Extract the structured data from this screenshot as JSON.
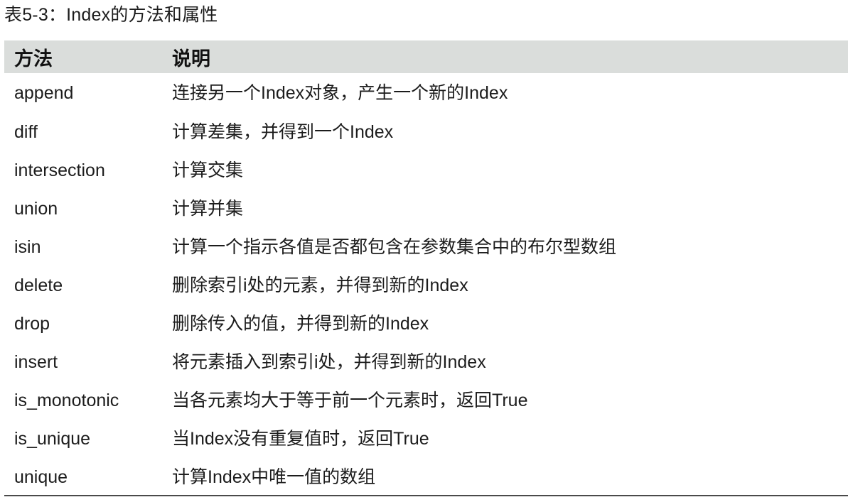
{
  "caption": "表5-3：Index的方法和属性",
  "table": {
    "columns": [
      {
        "key": "method",
        "label": "方法"
      },
      {
        "key": "description",
        "label": "说明"
      }
    ],
    "rows": [
      {
        "method": "append",
        "description": "连接另一个Index对象，产生一个新的Index"
      },
      {
        "method": "diff",
        "description": "计算差集，并得到一个Index"
      },
      {
        "method": "intersection",
        "description": "计算交集"
      },
      {
        "method": "union",
        "description": "计算并集"
      },
      {
        "method": "isin",
        "description": "计算一个指示各值是否都包含在参数集合中的布尔型数组"
      },
      {
        "method": "delete",
        "description": "删除索引i处的元素，并得到新的Index"
      },
      {
        "method": "drop",
        "description": "删除传入的值，并得到新的Index"
      },
      {
        "method": "insert",
        "description": "将元素插入到索引i处，并得到新的Index"
      },
      {
        "method": "is_monotonic",
        "description": "当各元素均大于等于前一个元素时，返回True"
      },
      {
        "method": "is_unique",
        "description": "当Index没有重复值时，返回True"
      },
      {
        "method": "unique",
        "description": "计算Index中唯一值的数组"
      }
    ]
  },
  "colors": {
    "header_background": "#dadddb",
    "page_background": "#ffffff",
    "text": "#1c1c1c",
    "bottom_rule": "#4a4a4a"
  }
}
